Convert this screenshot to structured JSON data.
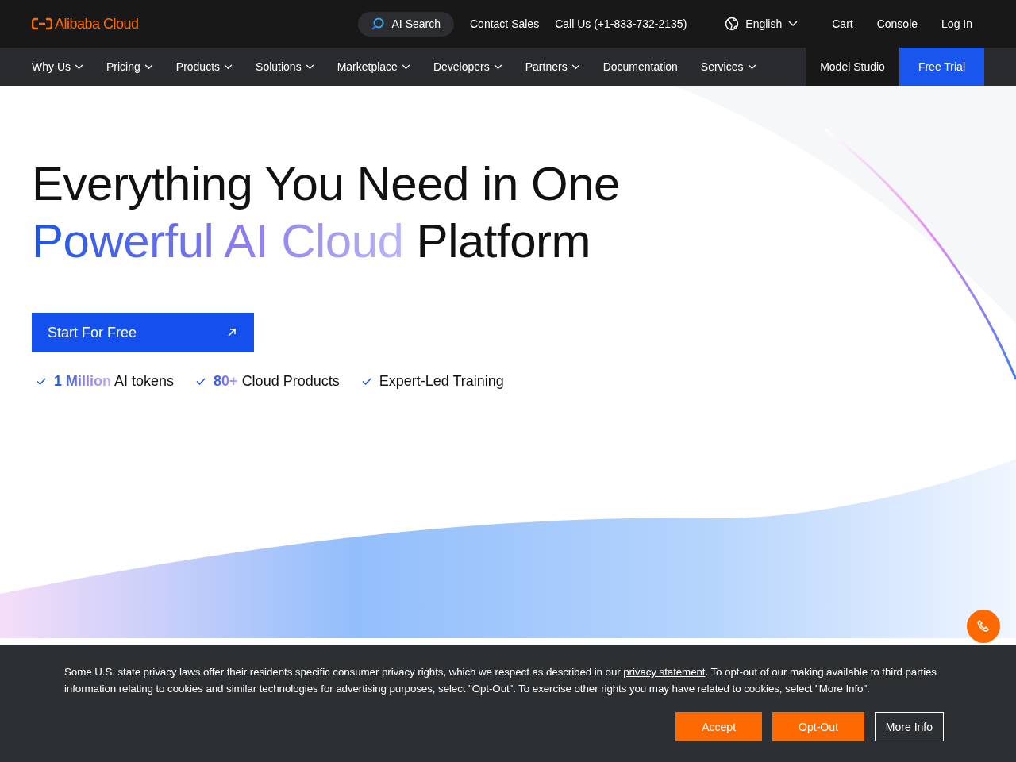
{
  "header": {
    "logo": "Alibaba Cloud",
    "search_button": "AI Search",
    "links": [
      "Contact Sales",
      "Call Us (+1-833-732-2135)"
    ],
    "language": "English",
    "account_links": [
      "Cart",
      "Console",
      "Log In"
    ]
  },
  "nav": {
    "items": [
      {
        "label": "Why Us",
        "dropdown": true
      },
      {
        "label": "Pricing",
        "dropdown": true
      },
      {
        "label": "Products",
        "dropdown": true
      },
      {
        "label": "Solutions",
        "dropdown": true
      },
      {
        "label": "Marketplace",
        "dropdown": true
      },
      {
        "label": "Developers",
        "dropdown": true
      },
      {
        "label": "Partners",
        "dropdown": true
      },
      {
        "label": "Documentation",
        "dropdown": false
      },
      {
        "label": "Services",
        "dropdown": true
      }
    ],
    "model_studio": "Model Studio",
    "free_trial": "Free Trial"
  },
  "hero": {
    "title_line1": "Everything You Need in One",
    "title_highlight": "Powerful AI Cloud",
    "title_rest": "Platform",
    "cta": "Start For Free",
    "features": [
      {
        "highlight": "1 Million",
        "text": "AI tokens"
      },
      {
        "highlight": "80+",
        "text": "Cloud Products"
      },
      {
        "text": "Expert-Led Training"
      }
    ]
  },
  "cookie_banner": {
    "text_before": "Some U.S. state privacy laws offer their residents specific consumer privacy rights, which we respect as described in our ",
    "link": "privacy statement",
    "text_after": ". To opt-out of our making available to third parties information relating to cookies and similar technologies for advertising purposes, select \"Opt-Out\". To exercise other rights you may have related to cookies, select \"More Info\".",
    "buttons": [
      "Accept",
      "Opt-Out",
      "More Info"
    ]
  }
}
